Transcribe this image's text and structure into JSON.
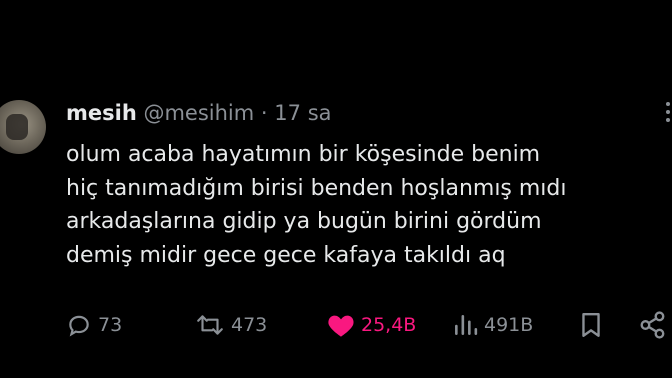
{
  "tweet": {
    "author_name": "mesih",
    "handle": "@mesihim",
    "separator": "·",
    "time": "17 sa",
    "text_lines": [
      "olum acaba hayatımın bir köşesinde benim",
      "hiç tanımadığım birisi benden hoşlanmış mıdı",
      "arkadaşlarına gidip ya bugün birini gördüm",
      "demiş midir gece gece kafaya takıldı aq"
    ]
  },
  "actions": {
    "replies": "73",
    "retweets": "473",
    "likes": "25,4B",
    "views": "491B"
  },
  "icons": {
    "reply": "reply-icon",
    "retweet": "retweet-icon",
    "like": "heart-icon",
    "views": "views-icon",
    "bookmark": "bookmark-icon",
    "share": "share-icon",
    "more": "more-icon"
  },
  "colors": {
    "background": "#000000",
    "text": "#e7e9ea",
    "muted": "#8b9096",
    "like_active": "#f91880"
  }
}
